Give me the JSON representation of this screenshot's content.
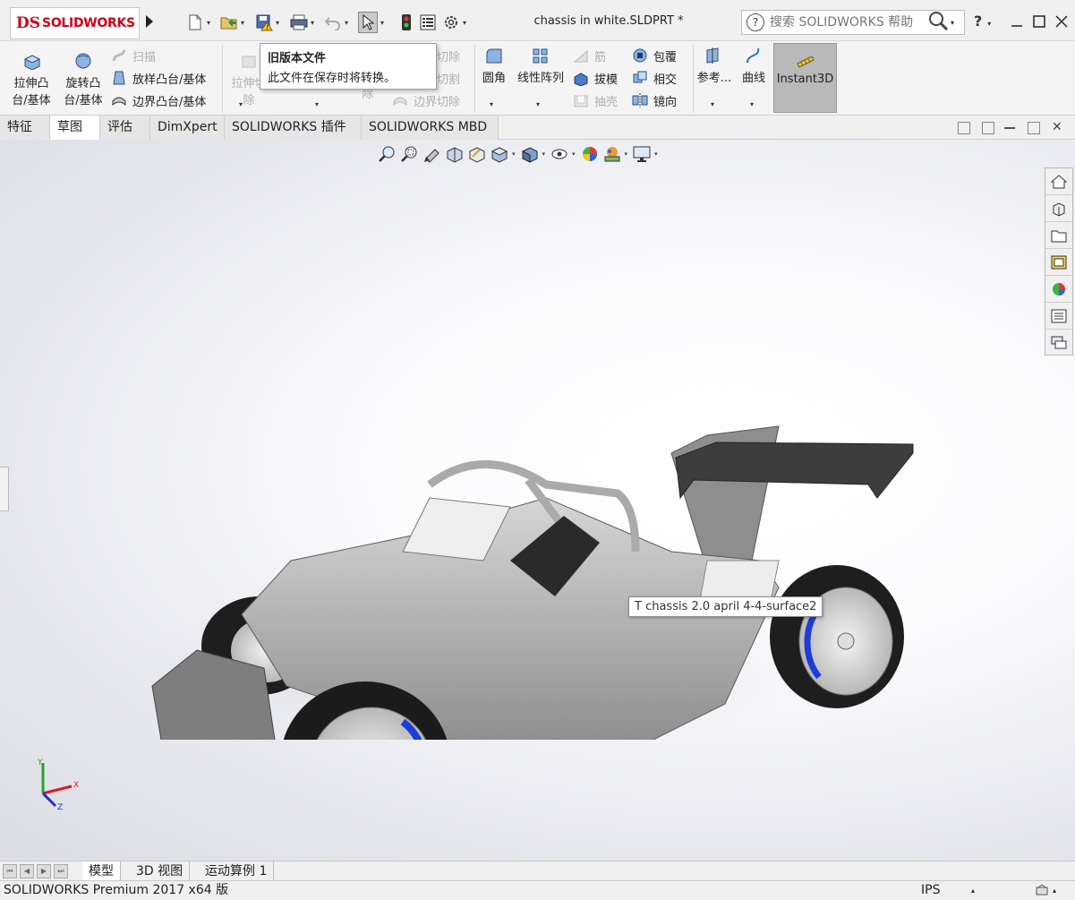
{
  "app": {
    "logo_ds": "DS",
    "logo_text": "SOLIDWORKS",
    "doc_title": "chassis in white.SLDPRT *"
  },
  "search": {
    "placeholder": "搜索 SOLIDWORKS 帮助"
  },
  "help": {
    "label": "?"
  },
  "ribbon": {
    "extrude_boss": "拉伸凸\n台/基体",
    "revolve_boss": "旋转凸\n台/基体",
    "sweep": "扫描",
    "loft_boss": "放样凸台/基体",
    "boundary_boss": "边界凸台/基体",
    "extrude_cut": "拉伸切\n除",
    "revolve_cut": "除",
    "sweep_cut": "切除",
    "loft_cut": "切割",
    "boundary_cut": "边界切除",
    "fillet": "圆角",
    "linear_pattern": "线性阵列",
    "rib": "筋",
    "draft": "拔模",
    "shell": "抽壳",
    "wrap": "包覆",
    "intersect": "相交",
    "mirror": "镜向",
    "reference": "参考...",
    "curves": "曲线",
    "instant3d": "Instant3D"
  },
  "tooltip": {
    "title": "旧版本文件",
    "body": "此文件在保存时将转换。"
  },
  "command_tabs": [
    {
      "label": "特征"
    },
    {
      "label": "草图"
    },
    {
      "label": "评估"
    },
    {
      "label": "DimXpert"
    },
    {
      "label": "SOLIDWORKS 插件"
    },
    {
      "label": "SOLIDWORKS MBD"
    }
  ],
  "viewport": {
    "hover_label": "T chassis 2.0 april 4-4-surface2",
    "triad": {
      "x": "X",
      "y": "Y",
      "z": "Z"
    }
  },
  "bottom_tabs": [
    {
      "label": "模型"
    },
    {
      "label": "3D 视图"
    },
    {
      "label": "运动算例 1"
    }
  ],
  "status": {
    "product": "SOLIDWORKS Premium 2017 x64 版",
    "units": "IPS"
  },
  "colors": {
    "brand_red": "#d0021b",
    "accent_blue": "#1e3cd6",
    "active_tab": "#ffffff"
  }
}
